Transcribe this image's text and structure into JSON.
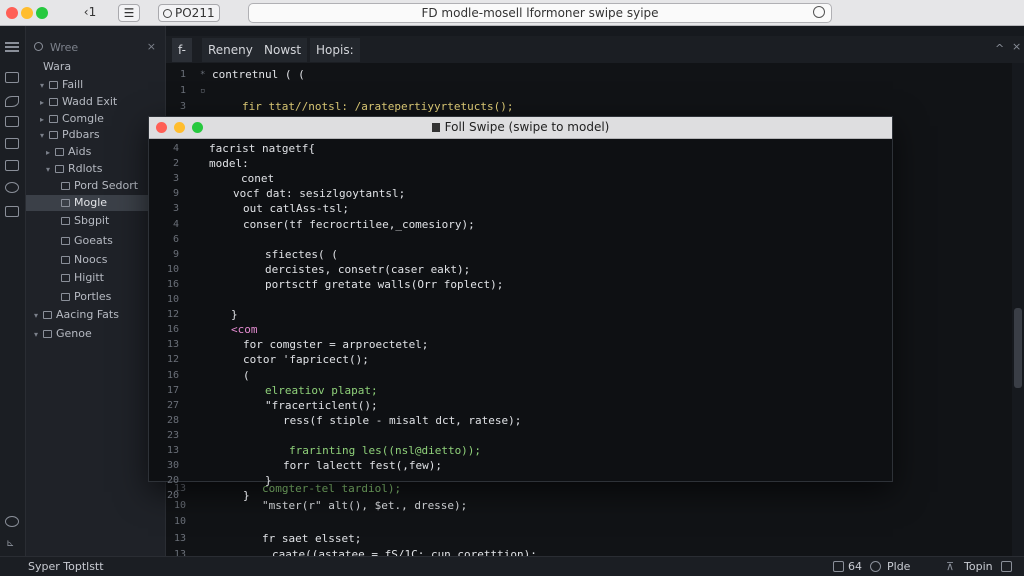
{
  "titlebar": {
    "back_label": "‹1",
    "sidebar_toggle": "☰",
    "branch_label": "PO211",
    "address": "FD modle-mosell lformoner swipe syipe"
  },
  "sidebar": {
    "search_placeholder": "Wree",
    "search_close": "×",
    "items": [
      {
        "label": "Wara",
        "chev": "",
        "icon": false
      },
      {
        "label": "Faill",
        "chev": "▾",
        "icon": true
      },
      {
        "label": "Wadd Exit",
        "chev": "▸",
        "icon": true
      },
      {
        "label": "Comgle",
        "chev": "▸",
        "icon": true
      },
      {
        "label": "Pdbars",
        "chev": "▾",
        "icon": true
      },
      {
        "label": "Aids",
        "chev": "▸",
        "icon": true
      },
      {
        "label": "Rdlots",
        "chev": "▾",
        "icon": true
      },
      {
        "label": "Pord Sedort",
        "chev": "",
        "icon": true
      },
      {
        "label": "Mogle",
        "chev": "",
        "icon": true
      },
      {
        "label": "Sbgpit",
        "chev": "",
        "icon": true
      },
      {
        "label": "Goeats",
        "chev": "",
        "icon": true
      },
      {
        "label": "Noocs",
        "chev": "",
        "icon": true
      },
      {
        "label": "Higitt",
        "chev": "",
        "icon": true
      },
      {
        "label": "Portles",
        "chev": "",
        "icon": true
      },
      {
        "label": "Aacing Fats",
        "chev": "▾",
        "icon": true
      },
      {
        "label": "Genoe",
        "chev": "▾",
        "icon": true
      }
    ]
  },
  "tabs": [
    {
      "label": "f-"
    },
    {
      "label": "Reneny"
    },
    {
      "label": "Nowst"
    },
    {
      "label": "Hopis:"
    }
  ],
  "editor": {
    "lines": [
      {
        "n": "1",
        "text": "contretnul ( (",
        "cls": "c-white",
        "mark": "*"
      },
      {
        "n": "1",
        "text": "",
        "cls": "c-white",
        "mark": "▫"
      },
      {
        "n": "3",
        "text": "fir ttat//notsl: /aratepertiyyrtetucts();",
        "cls": "c-yellow",
        "mark": ""
      }
    ],
    "bottom_lines": [
      {
        "n": "13",
        "text": "comgter-tel tardiol);",
        "cls": "c-green"
      },
      {
        "n": "10",
        "text": "\"mster(r\" alt(), $et., dresse);",
        "cls": "c-white"
      },
      {
        "n": "10",
        "text": "",
        "cls": "c-white"
      },
      {
        "n": "13",
        "text": "fr saet elsset;",
        "cls": "c-white"
      },
      {
        "n": "13",
        "text": "caate((astatee = fS/1C; cun coretttion);",
        "cls": "c-white"
      }
    ]
  },
  "popup": {
    "title": "Foll Swipe (swipe to model)",
    "lines": [
      {
        "n": "4",
        "text": "facrist natgetf{",
        "cls": "c-white"
      },
      {
        "n": "2",
        "text": "model:",
        "cls": "c-white"
      },
      {
        "n": "3",
        "text": "conet",
        "cls": "c-white"
      },
      {
        "n": "9",
        "text": "vocf dat: sesizlgoytantsl;",
        "cls": "c-white"
      },
      {
        "n": "3",
        "text": "out catlAss-tsl;",
        "cls": "c-white"
      },
      {
        "n": "4",
        "text": "conser(tf fecrocrtilee,_comesiory);",
        "cls": "c-white"
      },
      {
        "n": "6",
        "text": "",
        "cls": "c-white"
      },
      {
        "n": "9",
        "text": "sfiectes( (",
        "cls": "c-white"
      },
      {
        "n": "10",
        "text": "dercistes, consetr(caser eakt);",
        "cls": "c-white"
      },
      {
        "n": "16",
        "text": "portsctf gretate walls(Orr foplect);",
        "cls": "c-white"
      },
      {
        "n": "10",
        "text": "",
        "cls": "c-white"
      },
      {
        "n": "12",
        "text": "}",
        "cls": "c-white"
      },
      {
        "n": "16",
        "text": "<com",
        "cls": "c-pink"
      },
      {
        "n": "13",
        "text": "for comgster = arproectetel;",
        "cls": "c-white"
      },
      {
        "n": "12",
        "text": "cotor 'fapricect();",
        "cls": "c-white"
      },
      {
        "n": "16",
        "text": "(",
        "cls": "c-white"
      },
      {
        "n": "17",
        "text": "elreatiov plapat;",
        "cls": "c-green"
      },
      {
        "n": "27",
        "text": "\"fracerticlent();",
        "cls": "c-white"
      },
      {
        "n": "28",
        "text": "ress(f stiple - misalt dct, ratese);",
        "cls": "c-white"
      },
      {
        "n": "23",
        "text": "",
        "cls": "c-white"
      },
      {
        "n": "13",
        "text": "frarinting les((nsl@dietto));",
        "cls": "c-green"
      },
      {
        "n": "30",
        "text": "forr lalectt fest(,few);",
        "cls": "c-white"
      },
      {
        "n": "20",
        "text": "}",
        "cls": "c-white"
      },
      {
        "n": "20",
        "text": "}",
        "cls": "c-white"
      }
    ]
  },
  "status": {
    "left": "Syper Toptlstt",
    "line_col": "64",
    "mode": "Plde",
    "lang": "Topin"
  },
  "colors": {
    "close": "#ff5f56",
    "minimize": "#ffbd2e",
    "maximize": "#27c93f"
  }
}
